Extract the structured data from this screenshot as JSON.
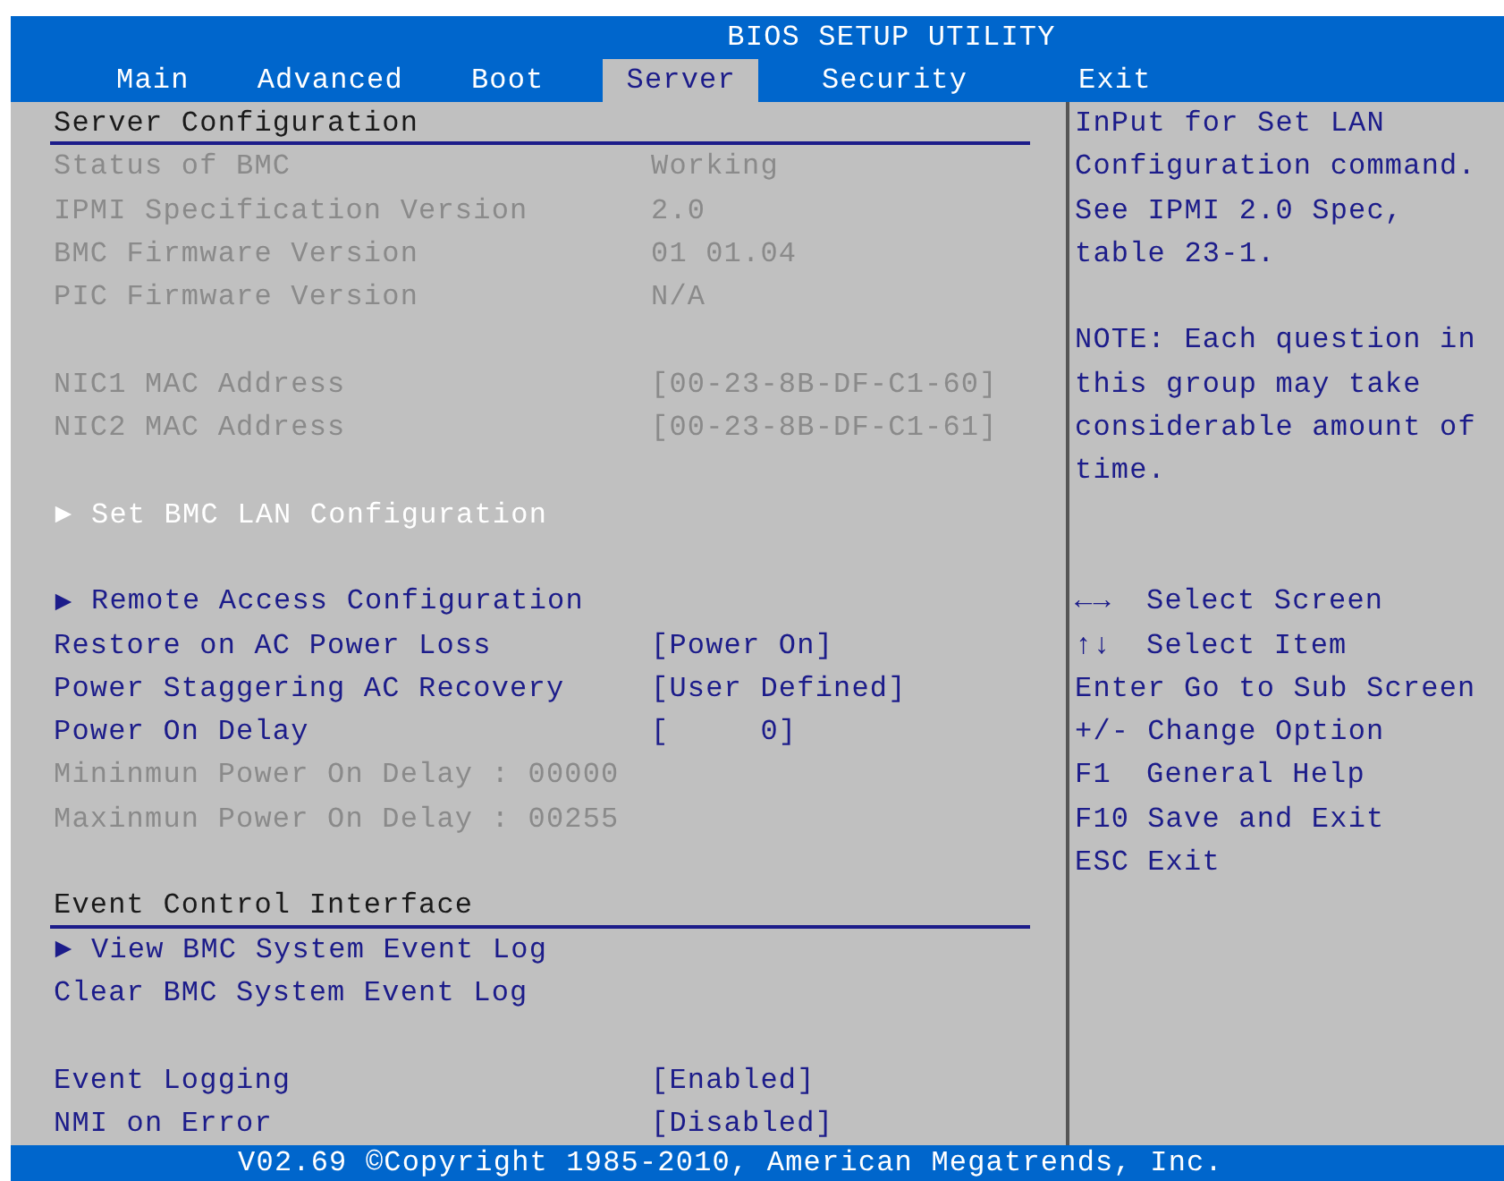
{
  "window": {
    "title": "BIOS SETUP UTILITY"
  },
  "tabs": [
    {
      "label": "Main",
      "selected": false
    },
    {
      "label": "Advanced",
      "selected": false
    },
    {
      "label": "Boot",
      "selected": false
    },
    {
      "label": "Server",
      "selected": true
    },
    {
      "label": "Security",
      "selected": false
    },
    {
      "label": "Exit",
      "selected": false
    }
  ],
  "items": [
    {
      "kind": "header",
      "label": "Server Configuration"
    },
    {
      "kind": "info",
      "label": "Status of BMC",
      "value": "Working"
    },
    {
      "kind": "info",
      "label": "IPMI Specification Version",
      "value": "2.0"
    },
    {
      "kind": "info",
      "label": "BMC Firmware Version",
      "value": "01 01.04"
    },
    {
      "kind": "info",
      "label": "PIC Firmware Version",
      "value": "N/A"
    },
    {
      "kind": "spacer"
    },
    {
      "kind": "info",
      "label": "NIC1 MAC Address",
      "value": "[00-23-8B-DF-C1-60]"
    },
    {
      "kind": "info",
      "label": "NIC2 MAC Address",
      "value": "[00-23-8B-DF-C1-61]"
    },
    {
      "kind": "spacer"
    },
    {
      "kind": "submenu",
      "label": "Set BMC LAN Configuration",
      "selected": true
    },
    {
      "kind": "spacer"
    },
    {
      "kind": "submenu",
      "label": "Remote Access Configuration",
      "selected": false
    },
    {
      "kind": "setting",
      "label": "Restore on AC Power Loss",
      "value": "[Power On]",
      "selected": false
    },
    {
      "kind": "setting",
      "label": "Power Staggering AC Recovery",
      "value": "[User Defined]",
      "selected": false
    },
    {
      "kind": "setting",
      "label": "Power On Delay",
      "value": "[     0]",
      "selected": false
    },
    {
      "kind": "info",
      "label": "Mininmun Power On Delay : 00000"
    },
    {
      "kind": "info",
      "label": "Maxinmun Power On Delay : 00255"
    },
    {
      "kind": "spacer"
    },
    {
      "kind": "header",
      "label": "Event Control Interface"
    },
    {
      "kind": "submenu",
      "label": "View BMC System Event Log",
      "selected": false
    },
    {
      "kind": "action",
      "label": "Clear BMC System Event Log",
      "selected": false
    },
    {
      "kind": "spacer"
    },
    {
      "kind": "setting",
      "label": "Event Logging",
      "value": "[Enabled]",
      "selected": false
    },
    {
      "kind": "setting",
      "label": "NMI on Error",
      "value": "[Disabled]",
      "selected": false
    }
  ],
  "help": [
    "InPut for Set LAN Configuration command. See IPMI 2.0 Spec, table 23-1.",
    "NOTE: Each question in this group may take considerable amount of time."
  ],
  "keys": [
    {
      "key": "←→",
      "action": "Select Screen"
    },
    {
      "key": "↑↓",
      "action": "Select Item"
    },
    {
      "key": "Enter",
      "action": "Go to Sub Screen"
    },
    {
      "key": "+/-",
      "action": "Change Option"
    },
    {
      "key": "F1",
      "action": "General Help"
    },
    {
      "key": "F10",
      "action": "Save and Exit"
    },
    {
      "key": "ESC",
      "action": "Exit"
    }
  ],
  "status_bar": "V02.69 ©Copyright 1985-2010, American Megatrends, Inc."
}
